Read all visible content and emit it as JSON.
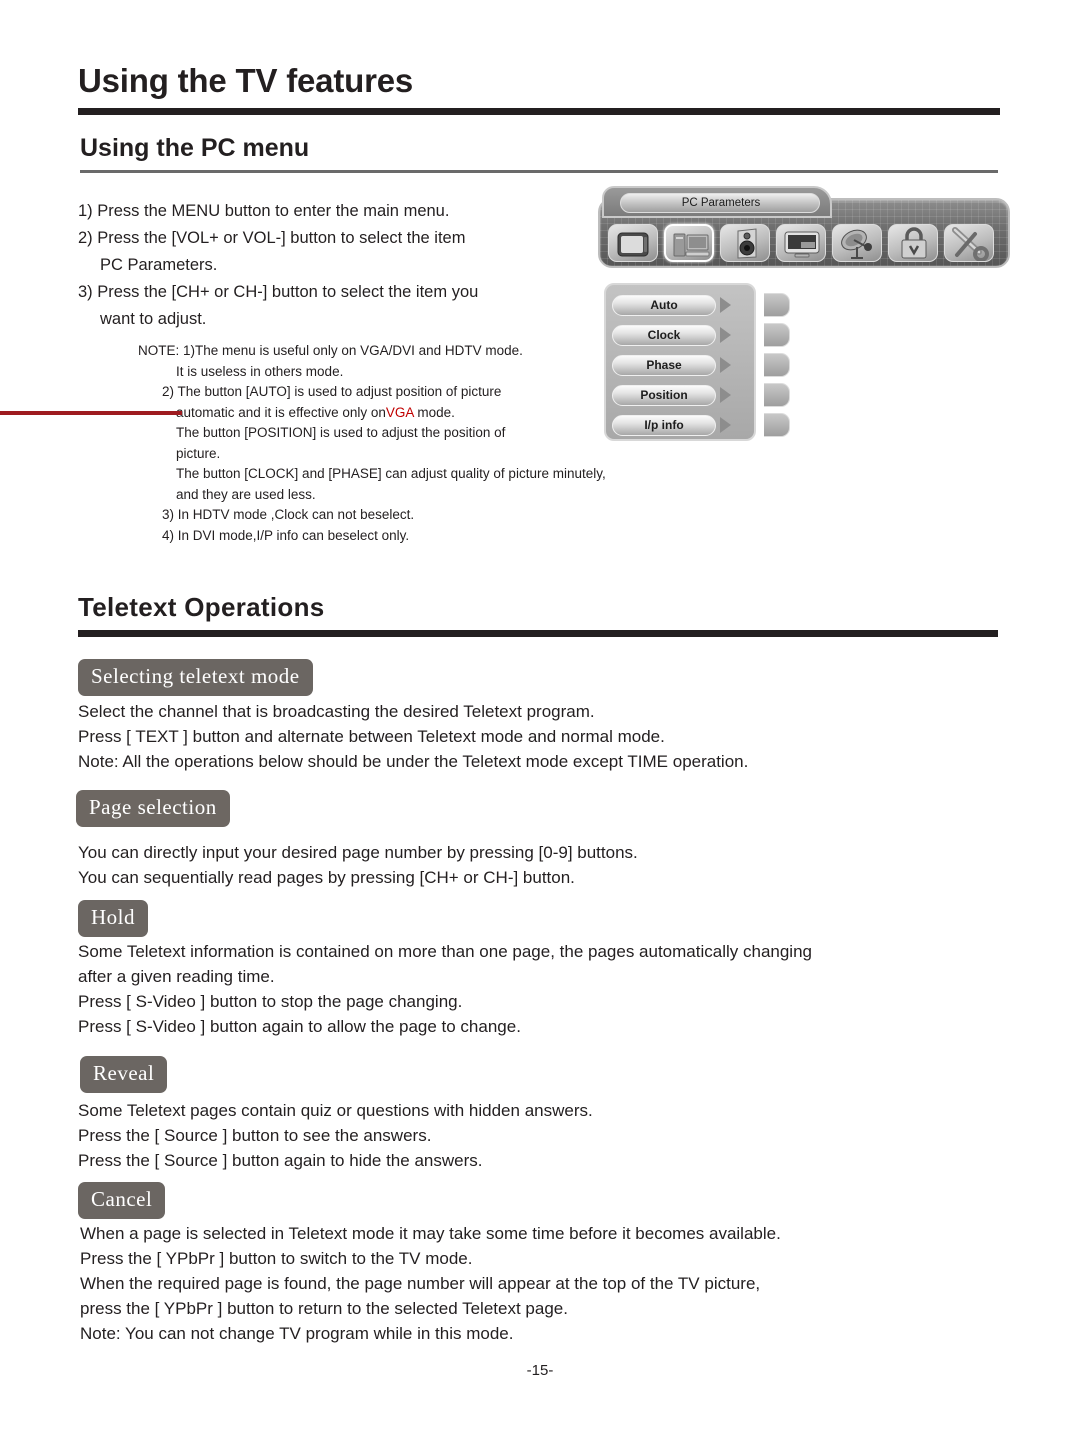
{
  "page": {
    "chapter_title": "Using the TV features",
    "section_title": "Using the PC menu",
    "page_number": "-15-"
  },
  "pc_menu": {
    "steps": [
      "1) Press the MENU button to enter the main menu.",
      "2) Press the [VOL+ or VOL-] button to select the item",
      "PC Parameters.",
      "3) Press the [CH+ or CH-] button to select the item you",
      "want to adjust."
    ],
    "note": {
      "line1": "NOTE: 1)The  menu is useful only on VGA/DVI and HDTV mode.",
      "line2": "It  is useless in others mode.",
      "line3": "2)  The button [AUTO] is used to adjust position of picture",
      "line4_a": "automatic and it is effective only on",
      "line4_red": "VGA",
      "line4_b": " mode.",
      "line5": "The button [POSITION] is used to adjust the position of",
      "line6": "picture.",
      "line7": "The button [CLOCK] and [PHASE] can adjust quality of picture minutely,",
      "line8": "and they are used less.",
      "line9": "3)  In HDTV mode ,Clock can not beselect.",
      "line10": "4)  In DVI mode,I/P info can beselect only."
    }
  },
  "osd": {
    "tab_label": "PC Parameters",
    "icons": [
      {
        "name": "tv-icon",
        "selected": false
      },
      {
        "name": "pc-icon",
        "selected": true
      },
      {
        "name": "speaker-icon",
        "selected": false
      },
      {
        "name": "screen-icon",
        "selected": false
      },
      {
        "name": "satellite-dish-icon",
        "selected": false
      },
      {
        "name": "lock-icon",
        "selected": false
      },
      {
        "name": "tools-icon",
        "selected": false
      }
    ],
    "menu_items": [
      "Auto",
      "Clock",
      "Phase",
      "Position",
      "I/p info"
    ]
  },
  "teletext": {
    "title": "Teletext Operations",
    "sections": [
      {
        "badge": "Selecting teletext mode",
        "lines": [
          "Select the channel that is broadcasting the desired Teletext program.",
          "Press [ TEXT ] button and alternate between Teletext mode and normal mode.",
          "Note: All the operations below should be under the Teletext mode except TIME operation."
        ]
      },
      {
        "badge": "Page  selection",
        "lines": [
          "You can directly input your desired page number by pressing [0-9] buttons.",
          "You can sequentially read pages by pressing [CH+ or CH-] button."
        ]
      },
      {
        "badge": "Hold",
        "lines": [
          "Some Teletext information is contained on more than one page, the pages automatically changing",
          "after a given reading time.",
          "Press [ S-Video ] button to stop the page changing.",
          "Press [ S-Video ] button again to allow the page to change."
        ]
      },
      {
        "badge": "Reveal",
        "lines": [
          "Some Teletext pages contain quiz or questions with hidden answers.",
          "Press the [ Source ] button to see the answers.",
          "Press the [ Source   ] button again to hide the answers."
        ]
      },
      {
        "badge": "Cancel",
        "lines": [
          "When a page is selected in Teletext mode it may take some time before it becomes available.",
          "Press the [ YPbPr ] button to switch to the TV mode.",
          "When the required page is found, the page number will appear at the top of the TV picture,",
          "press the [ YPbPr ] button to return to the selected Teletext page.",
          "Note: You can not change TV program while in this mode."
        ]
      }
    ]
  },
  "colors": {
    "rule_dark": "#231f20",
    "rule_gray": "#6a6a6a",
    "accent_red": "#c00000",
    "margin_red": "#9e1b20",
    "badge_gray": "#6b6662"
  }
}
